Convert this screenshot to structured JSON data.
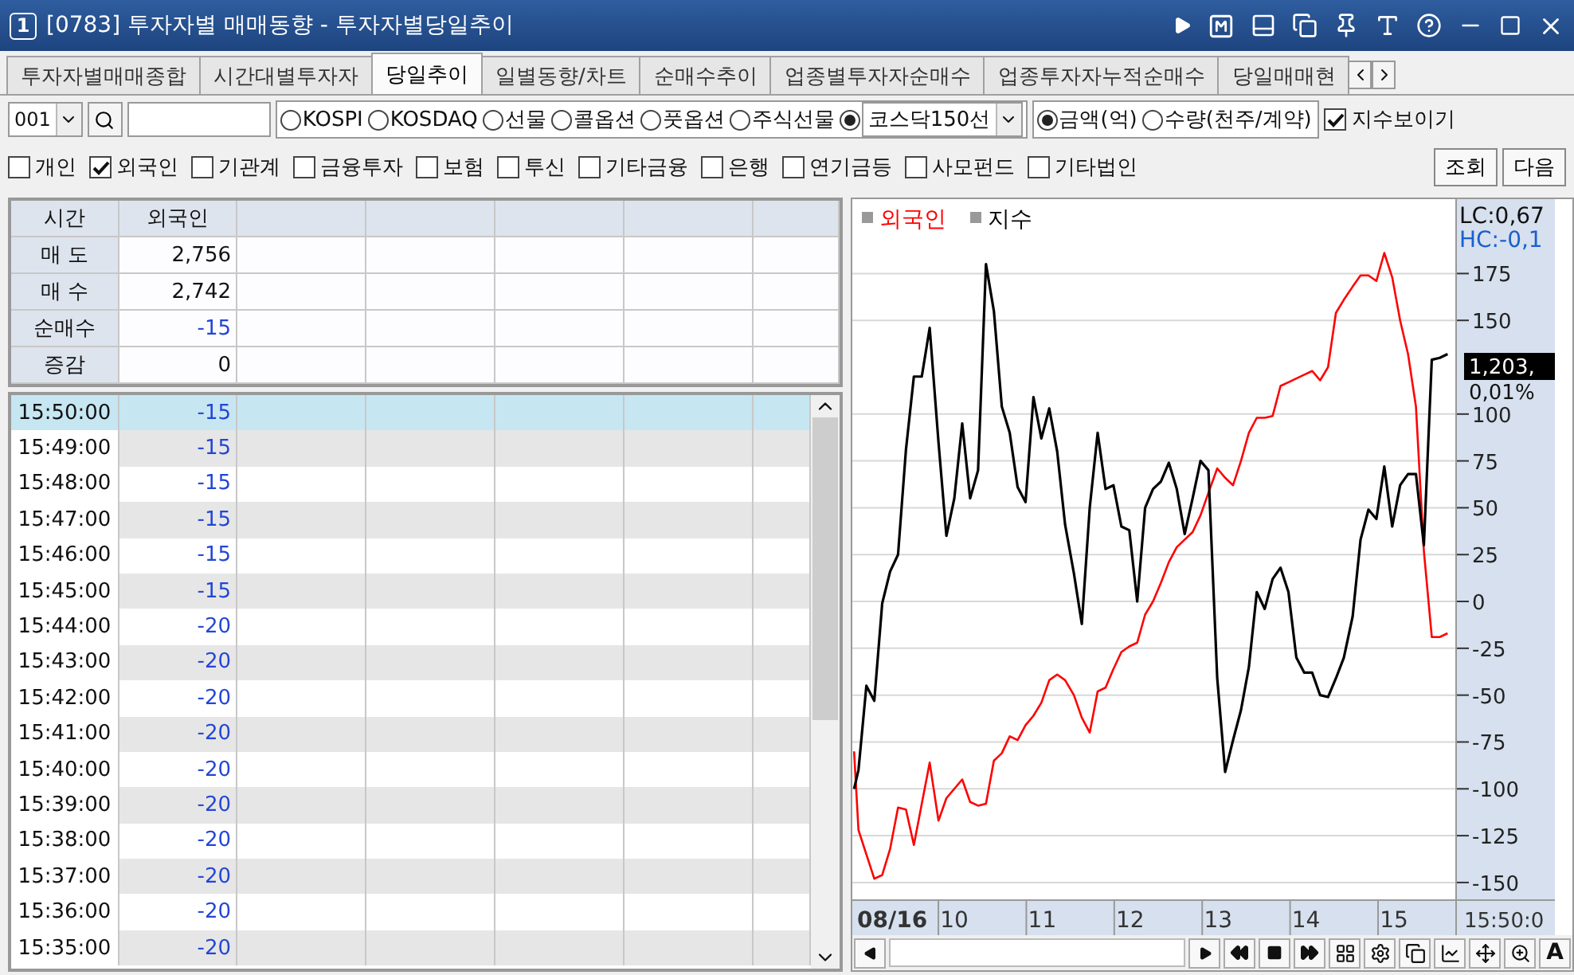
{
  "window": {
    "badge": "1",
    "title": "[0783] 투자자별 매매동향 - 투자자별당일추이"
  },
  "tabs": [
    {
      "label": "투자자별매매종합",
      "selected": false
    },
    {
      "label": "시간대별투자자",
      "selected": false
    },
    {
      "label": "당일추이",
      "selected": true
    },
    {
      "label": "일별동향/차트",
      "selected": false
    },
    {
      "label": "순매수추이",
      "selected": false
    },
    {
      "label": "업종별투자자순매수",
      "selected": false
    },
    {
      "label": "업종투자자누적순매수",
      "selected": false
    },
    {
      "label": "당일매매현",
      "selected": false
    }
  ],
  "options": {
    "code": "001",
    "markets": [
      {
        "kind": "radio",
        "label": "KOSPI",
        "selected": false
      },
      {
        "kind": "radio",
        "label": "KOSDAQ",
        "selected": false
      },
      {
        "kind": "radio",
        "label": "선물",
        "selected": false
      },
      {
        "kind": "radio",
        "label": "콜옵션",
        "selected": false
      },
      {
        "kind": "radio",
        "label": "풋옵션",
        "selected": false
      },
      {
        "kind": "radio",
        "label": "주식선물",
        "selected": false
      },
      {
        "kind": "combo",
        "label": "코스닥150선",
        "selected": true
      }
    ],
    "units": [
      {
        "label": "금액(억)",
        "selected": true
      },
      {
        "label": "수량(천주/계약)",
        "selected": false
      }
    ],
    "show_index": {
      "label": "지수보이기",
      "checked": true
    }
  },
  "investors": [
    {
      "label": "개인",
      "checked": false
    },
    {
      "label": "외국인",
      "checked": true
    },
    {
      "label": "기관계",
      "checked": false
    },
    {
      "label": "금융투자",
      "checked": false
    },
    {
      "label": "보험",
      "checked": false
    },
    {
      "label": "투신",
      "checked": false
    },
    {
      "label": "기타금융",
      "checked": false
    },
    {
      "label": "은행",
      "checked": false
    },
    {
      "label": "연기금등",
      "checked": false
    },
    {
      "label": "사모펀드",
      "checked": false
    },
    {
      "label": "기타법인",
      "checked": false
    }
  ],
  "buttons": [
    "조회",
    "다음"
  ],
  "summary": {
    "columns": [
      "시간",
      "외국인"
    ],
    "rows": [
      {
        "label": "매 도",
        "value": "2,756",
        "color": "#111111"
      },
      {
        "label": "매 수",
        "value": "2,742",
        "color": "#111111"
      },
      {
        "label": "순매수",
        "value": "-15",
        "color": "#2346d6"
      },
      {
        "label": "증감",
        "value": "0",
        "color": "#111111"
      }
    ]
  },
  "rows": [
    {
      "time": "15:50:00",
      "value": "-15",
      "color": "#2346d6",
      "selected": true
    },
    {
      "time": "15:49:00",
      "value": "-15",
      "color": "#2346d6",
      "selected": false
    },
    {
      "time": "15:48:00",
      "value": "-15",
      "color": "#2346d6",
      "selected": false
    },
    {
      "time": "15:47:00",
      "value": "-15",
      "color": "#2346d6",
      "selected": false
    },
    {
      "time": "15:46:00",
      "value": "-15",
      "color": "#2346d6",
      "selected": false
    },
    {
      "time": "15:45:00",
      "value": "-15",
      "color": "#2346d6",
      "selected": false
    },
    {
      "time": "15:44:00",
      "value": "-20",
      "color": "#2346d6",
      "selected": false
    },
    {
      "time": "15:43:00",
      "value": "-20",
      "color": "#2346d6",
      "selected": false
    },
    {
      "time": "15:42:00",
      "value": "-20",
      "color": "#2346d6",
      "selected": false
    },
    {
      "time": "15:41:00",
      "value": "-20",
      "color": "#2346d6",
      "selected": false
    },
    {
      "time": "15:40:00",
      "value": "-20",
      "color": "#2346d6",
      "selected": false
    },
    {
      "time": "15:39:00",
      "value": "-20",
      "color": "#2346d6",
      "selected": false
    },
    {
      "time": "15:38:00",
      "value": "-20",
      "color": "#2346d6",
      "selected": false
    },
    {
      "time": "15:37:00",
      "value": "-20",
      "color": "#2346d6",
      "selected": false
    },
    {
      "time": "15:36:00",
      "value": "-20",
      "color": "#2346d6",
      "selected": false
    },
    {
      "time": "15:35:00",
      "value": "-20",
      "color": "#2346d6",
      "selected": false
    }
  ],
  "chart": {
    "date_label": "08/16",
    "lc": "LC:0,67",
    "hc": "HC:-0,1",
    "last_value": "1,203,",
    "last_change": "0,01%",
    "time_end": "15:50:0",
    "toolbar_text": "A",
    "chart_data": {
      "type": "line",
      "x": [
        8.86,
        8.91,
        9.0,
        9.09,
        9.18,
        9.27,
        9.36,
        9.45,
        9.54,
        9.63,
        9.72,
        9.82,
        9.91,
        10.0,
        10.09,
        10.18,
        10.27,
        10.36,
        10.45,
        10.54,
        10.63,
        10.72,
        10.81,
        10.9,
        10.99,
        11.08,
        11.17,
        11.26,
        11.36,
        11.45,
        11.54,
        11.63,
        11.72,
        11.81,
        11.9,
        11.99,
        12.08,
        12.17,
        12.26,
        12.35,
        12.44,
        12.53,
        12.62,
        12.71,
        12.8,
        12.89,
        12.99,
        13.08,
        13.17,
        13.26,
        13.35,
        13.44,
        13.53,
        13.62,
        13.71,
        13.8,
        13.89,
        13.98,
        14.07,
        14.16,
        14.25,
        14.34,
        14.43,
        14.53,
        14.62,
        14.71,
        14.8,
        14.89,
        14.98,
        15.07,
        15.16,
        15.25,
        15.34,
        15.43,
        15.52,
        15.61
      ],
      "series": [
        {
          "name": "외국인",
          "color": "#ff0000",
          "values": [
            -80,
            -122,
            -135,
            -148,
            -146,
            -132,
            -110,
            -111,
            -130,
            -108,
            -86,
            -117,
            -105,
            -100,
            -95,
            -107,
            -109,
            -108,
            -85,
            -81,
            -72,
            -74,
            -66,
            -61,
            -54,
            -42,
            -39,
            -42,
            -50,
            -62,
            -70,
            -48,
            -46,
            -36,
            -27,
            -24,
            -22,
            -7,
            0,
            10,
            21,
            29,
            33,
            37,
            46,
            58,
            71,
            66,
            62,
            75,
            90,
            98,
            98,
            99,
            115,
            117,
            119,
            121,
            123,
            118,
            125,
            154,
            161,
            168,
            174,
            174,
            171,
            186,
            173,
            150,
            132,
            104,
            27,
            -19,
            -19,
            -17
          ]
        },
        {
          "name": "지수",
          "color": "#000000",
          "values": [
            -100,
            -90,
            -45,
            -53,
            -1,
            16,
            25,
            81,
            120,
            120,
            146,
            85,
            35,
            55,
            95,
            55,
            70,
            180,
            155,
            104,
            90,
            61,
            53,
            109,
            87,
            103,
            80,
            41,
            15,
            -12,
            50,
            90,
            60,
            62,
            40,
            38,
            0,
            50,
            60,
            64,
            74,
            60,
            36,
            55,
            75,
            70,
            -41,
            -91,
            -74,
            -58,
            -35,
            5,
            -4,
            12,
            18,
            5,
            -30,
            -38,
            -38,
            -50,
            -51,
            -41,
            -30,
            -8,
            33,
            49,
            44,
            72,
            40,
            62,
            68,
            68,
            30,
            129,
            130,
            132
          ]
        }
      ],
      "xlim": [
        8.84,
        16.83
      ],
      "ylim": [
        -159.4,
        214.7
      ],
      "grid": true,
      "xticks": [
        10,
        11,
        12,
        13,
        14,
        15
      ],
      "yticks": [
        175,
        150,
        100,
        75,
        50,
        25,
        0,
        -25,
        -50,
        -75,
        -100,
        -125,
        -150
      ]
    }
  }
}
